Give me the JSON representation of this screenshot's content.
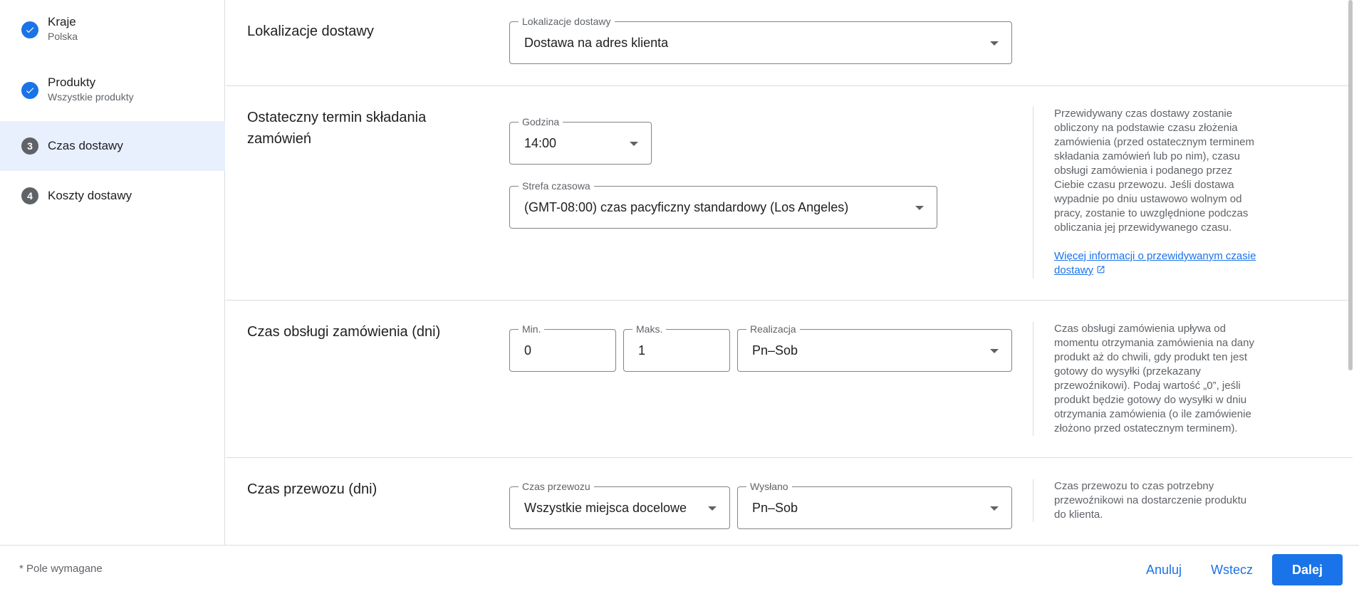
{
  "sidebar": {
    "steps": [
      {
        "title": "Kraje",
        "subtitle": "Polska",
        "state": "done",
        "icon": "check-icon"
      },
      {
        "title": "Produkty",
        "subtitle": "Wszystkie produkty",
        "state": "done",
        "icon": "check-icon"
      },
      {
        "number": "3",
        "title": "Czas dostawy",
        "state": "active"
      },
      {
        "number": "4",
        "title": "Koszty dostawy",
        "state": "pending"
      }
    ]
  },
  "sections": {
    "locations": {
      "title": "Lokalizacje dostawy",
      "field_label": "Lokalizacje dostawy",
      "field_value": "Dostawa na adres klienta"
    },
    "cutoff": {
      "title": "Ostateczny termin składania zamówień",
      "hour_label": "Godzina",
      "hour_value": "14:00",
      "tz_label": "Strefa czasowa",
      "tz_value": "(GMT-08:00) czas pacyficzny standardowy (Los Angeles)",
      "help": "Przewidywany czas dostawy zostanie obliczony na podstawie czasu złożenia zamówienia (przed ostatecznym terminem składania zamówień lub po nim), czasu obsługi zamówienia i podanego przez Ciebie czasu przewozu. Jeśli dostawa wypadnie po dniu ustawowo wolnym od pracy, zostanie to uwzględnione podczas obliczania jej przewidywanego czasu.",
      "help_link": "Więcej informacji o przewidywanym czasie dostawy"
    },
    "handling": {
      "title": "Czas obsługi zamówienia (dni)",
      "min_label": "Min.",
      "min_value": "0",
      "max_label": "Maks.",
      "max_value": "1",
      "days_label": "Realizacja",
      "days_value": "Pn–Sob",
      "help": "Czas obsługi zamówienia upływa od momentu otrzymania zamówienia na dany produkt aż do chwili, gdy produkt ten jest gotowy do wysyłki (przekazany przewoźnikowi). Podaj wartość „0”, jeśli produkt będzie gotowy do wysyłki w dniu otrzymania zamówienia (o ile zamówienie złożono przed ostatecznym terminem)."
    },
    "transit": {
      "title": "Czas przewozu (dni)",
      "transit_label": "Czas przewozu",
      "transit_value": "Wszystkie miejsca docelowe",
      "shipped_label": "Wysłano",
      "shipped_value": "Pn–Sob",
      "help": "Czas przewozu to czas potrzebny przewoźnikowi na dostarczenie produktu do klienta."
    }
  },
  "footer": {
    "required_note": "* Pole wymagane",
    "cancel": "Anuluj",
    "back": "Wstecz",
    "next": "Dalej"
  },
  "colors": {
    "accent": "#1a73e8",
    "active_step_bg": "#e8f0fe",
    "step_number_bg": "#5f6368"
  }
}
